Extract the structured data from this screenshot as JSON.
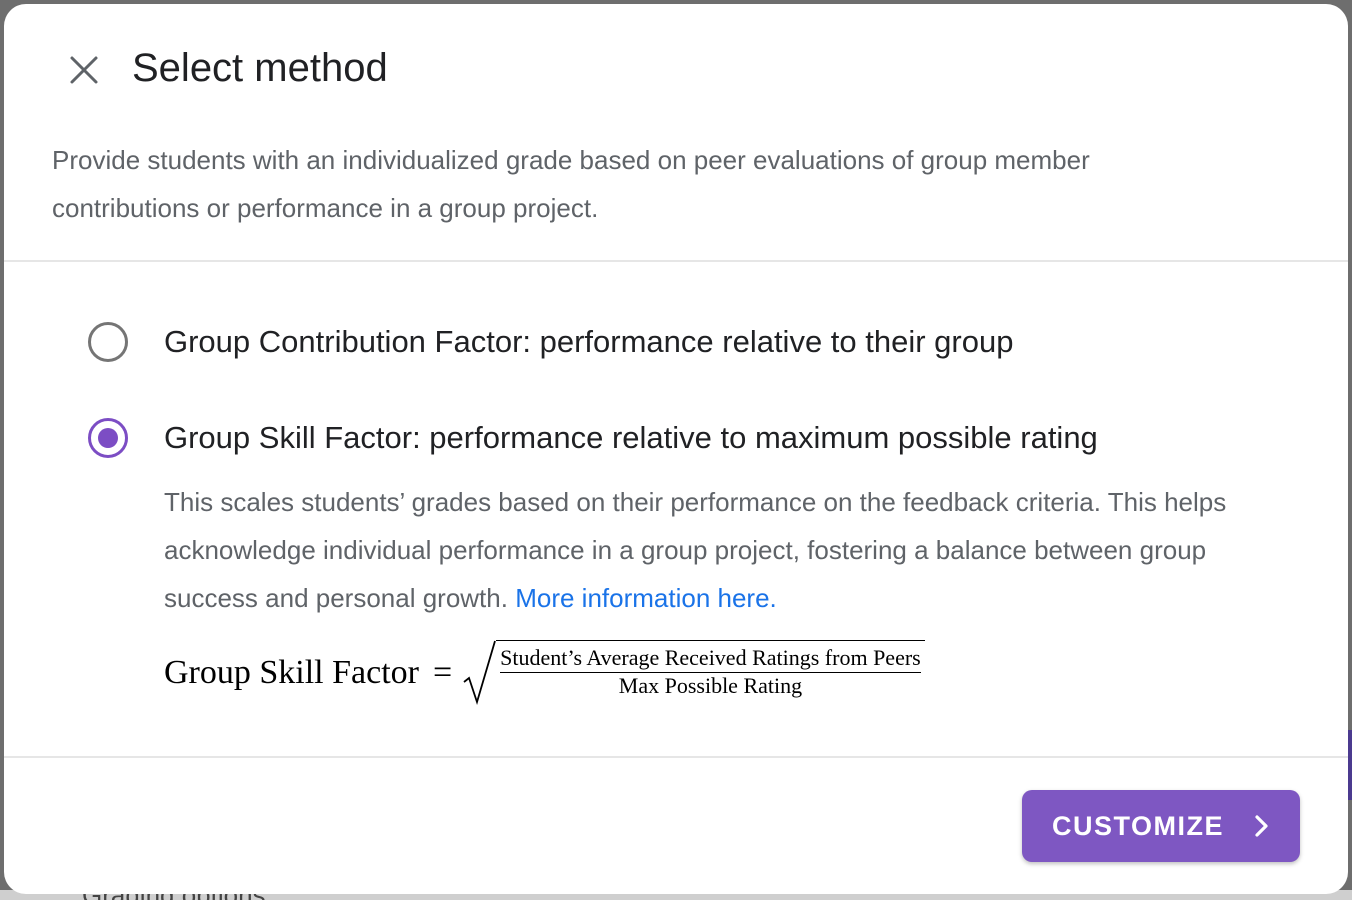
{
  "dialog": {
    "title": "Select method",
    "description": "Provide students with an individualized grade based on peer evaluations of group member contributions or performance in a group project."
  },
  "options": [
    {
      "label": "Group Contribution Factor: performance relative to their group",
      "selected": false
    },
    {
      "label": "Group Skill Factor: performance relative to maximum possible rating",
      "selected": true,
      "description": "This scales students’ grades based on their performance on the feedback criteria. This helps acknowledge individual performance in a group project, fostering a balance between group success and personal growth.",
      "link_text": "More information here."
    }
  ],
  "formula": {
    "lhs": "Group Skill Factor",
    "eq": "=",
    "numerator": "Student’s Average Received Ratings from Peers",
    "denominator": "Max Possible Rating"
  },
  "footer": {
    "customize_label": "CUSTOMIZE"
  },
  "background": {
    "partial_text": "Grading options"
  },
  "colors": {
    "accent": "#7e57c2",
    "radio_selected": "#7c4dc4",
    "link": "#1a73e8",
    "text_primary": "#202124",
    "text_secondary": "#5f6368"
  }
}
